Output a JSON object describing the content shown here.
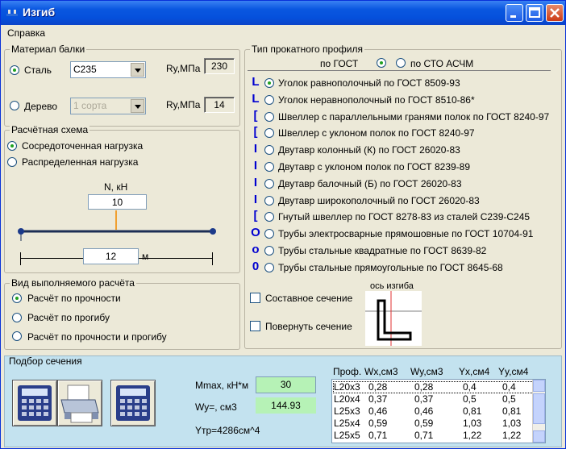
{
  "window": {
    "title": "Изгиб",
    "menu_help": "Справка"
  },
  "material": {
    "legend": "Материал балки",
    "steel_label": "Сталь",
    "steel_grade": "С235",
    "ry_label": "Ry,МПа",
    "steel_ry": "230",
    "wood_label": "Дерево",
    "wood_grade": "1 сорта",
    "wood_ry": "14"
  },
  "scheme": {
    "legend": "Расчётная схема",
    "concentrated": "Сосредоточенная нагрузка",
    "distributed": "Распределенная нагрузка",
    "load_label": "N, кН",
    "load_value": "10",
    "length_value": "12",
    "length_unit": "м"
  },
  "calc_type": {
    "legend": "Вид выполняемого расчёта",
    "strength": "Расчёт по прочности",
    "deflection": "Расчёт по прогибу",
    "both": "Расчёт по прочности и прогибу"
  },
  "profile": {
    "legend": "Тип прокатного профиля",
    "gost_label": "по ГОСТ",
    "sto_label": "по СТО АСЧМ",
    "items": [
      "Уголок равнополочный по ГОСТ 8509-93",
      "Уголок неравнополочный по ГОСТ 8510-86*",
      "Швеллер с параллельными гранями полок по ГОСТ 8240-97",
      "Швеллер с уклоном полок по ГОСТ 8240-97",
      "Двутавр колонный (К) по ГОСТ 26020-83",
      "Двутавр с уклоном полок по ГОСТ 8239-89",
      "Двутавр балочный (Б) по ГОСТ 26020-83",
      "Двутавр широкополочный по ГОСТ 26020-83",
      "Гнутый швеллер по ГОСТ 8278-83 из сталей С239-С245",
      "Трубы электросварные прямошовные по ГОСТ 10704-91",
      "Трубы стальные квадратные  по ГОСТ 8639-82",
      "Трубы стальные прямоугольные по ГОСТ 8645-68"
    ],
    "icons": [
      "L",
      "L",
      "[",
      "[",
      "I",
      "I",
      "I",
      "I",
      "[",
      "O",
      "o",
      "0"
    ],
    "composite": "Составное сечение",
    "rotate": "Повернуть сечение",
    "axis_label": "ось изгиба"
  },
  "selection": {
    "legend": "Подбор сечения",
    "mmax_label": "Mmax, кН*м",
    "mmax_value": "30",
    "wy_label": "Wy=, см3",
    "wy_value": "144.93",
    "ytr_label": "Yтр=4286см^4",
    "columns": [
      "Проф.",
      "Wx,см3",
      "Wy,см3",
      "Yx,см4",
      "Yy,см4"
    ],
    "rows": [
      [
        "L20x3",
        "0,28",
        "0,28",
        "0,4",
        "0,4"
      ],
      [
        "L20x4",
        "0,37",
        "0,37",
        "0,5",
        "0,5"
      ],
      [
        "L25x3",
        "0,46",
        "0,46",
        "0,81",
        "0,81"
      ],
      [
        "L25x4",
        "0,59",
        "0,59",
        "1,03",
        "1,03"
      ],
      [
        "L25x5",
        "0,71",
        "0,71",
        "1,22",
        "1,22"
      ]
    ]
  },
  "colors": {
    "title_bar": "#0a57e0",
    "window_bg": "#ece9d8",
    "selection_bg": "#c3e2ef",
    "highlight_green": "#b6f2b6",
    "axis_red": "#e03030",
    "icon_blue": "#0000d0"
  }
}
